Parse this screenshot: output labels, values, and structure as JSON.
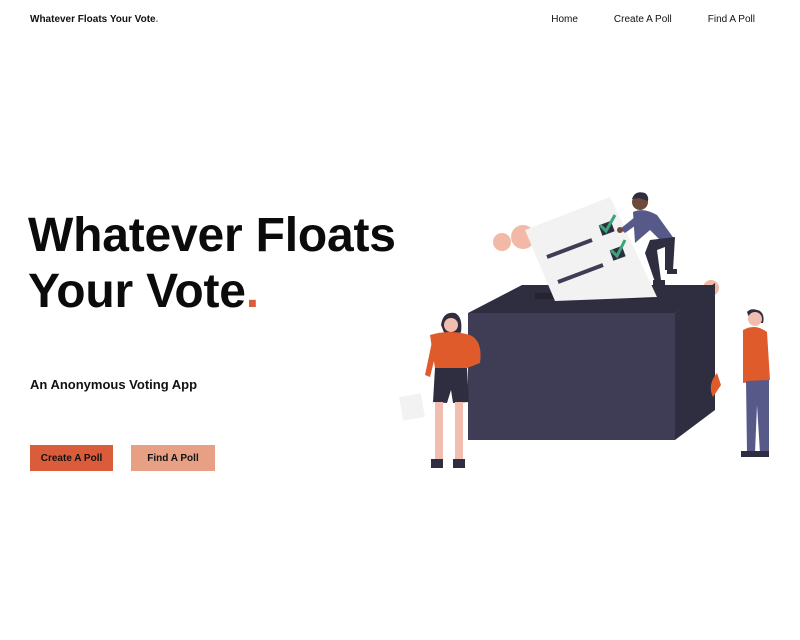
{
  "brand": {
    "name": "Whatever Floats Your Vote",
    "dot": "."
  },
  "nav": {
    "links": [
      {
        "label": "Home"
      },
      {
        "label": "Create A Poll"
      },
      {
        "label": "Find A Poll"
      }
    ]
  },
  "hero": {
    "title_line1": "Whatever Floats",
    "title_line2": "Your Vote",
    "dot": ".",
    "subtitle": "An Anonymous Voting App",
    "primary_button": "Create A Poll",
    "secondary_button": "Find A Poll"
  },
  "colors": {
    "accent": "#db5c3b",
    "accent_light": "#e8a085",
    "ballot_box": "#3f3d56",
    "person_shirt": "#e05b2b"
  },
  "illustration": {
    "name": "voting-ballot-box-illustration"
  }
}
